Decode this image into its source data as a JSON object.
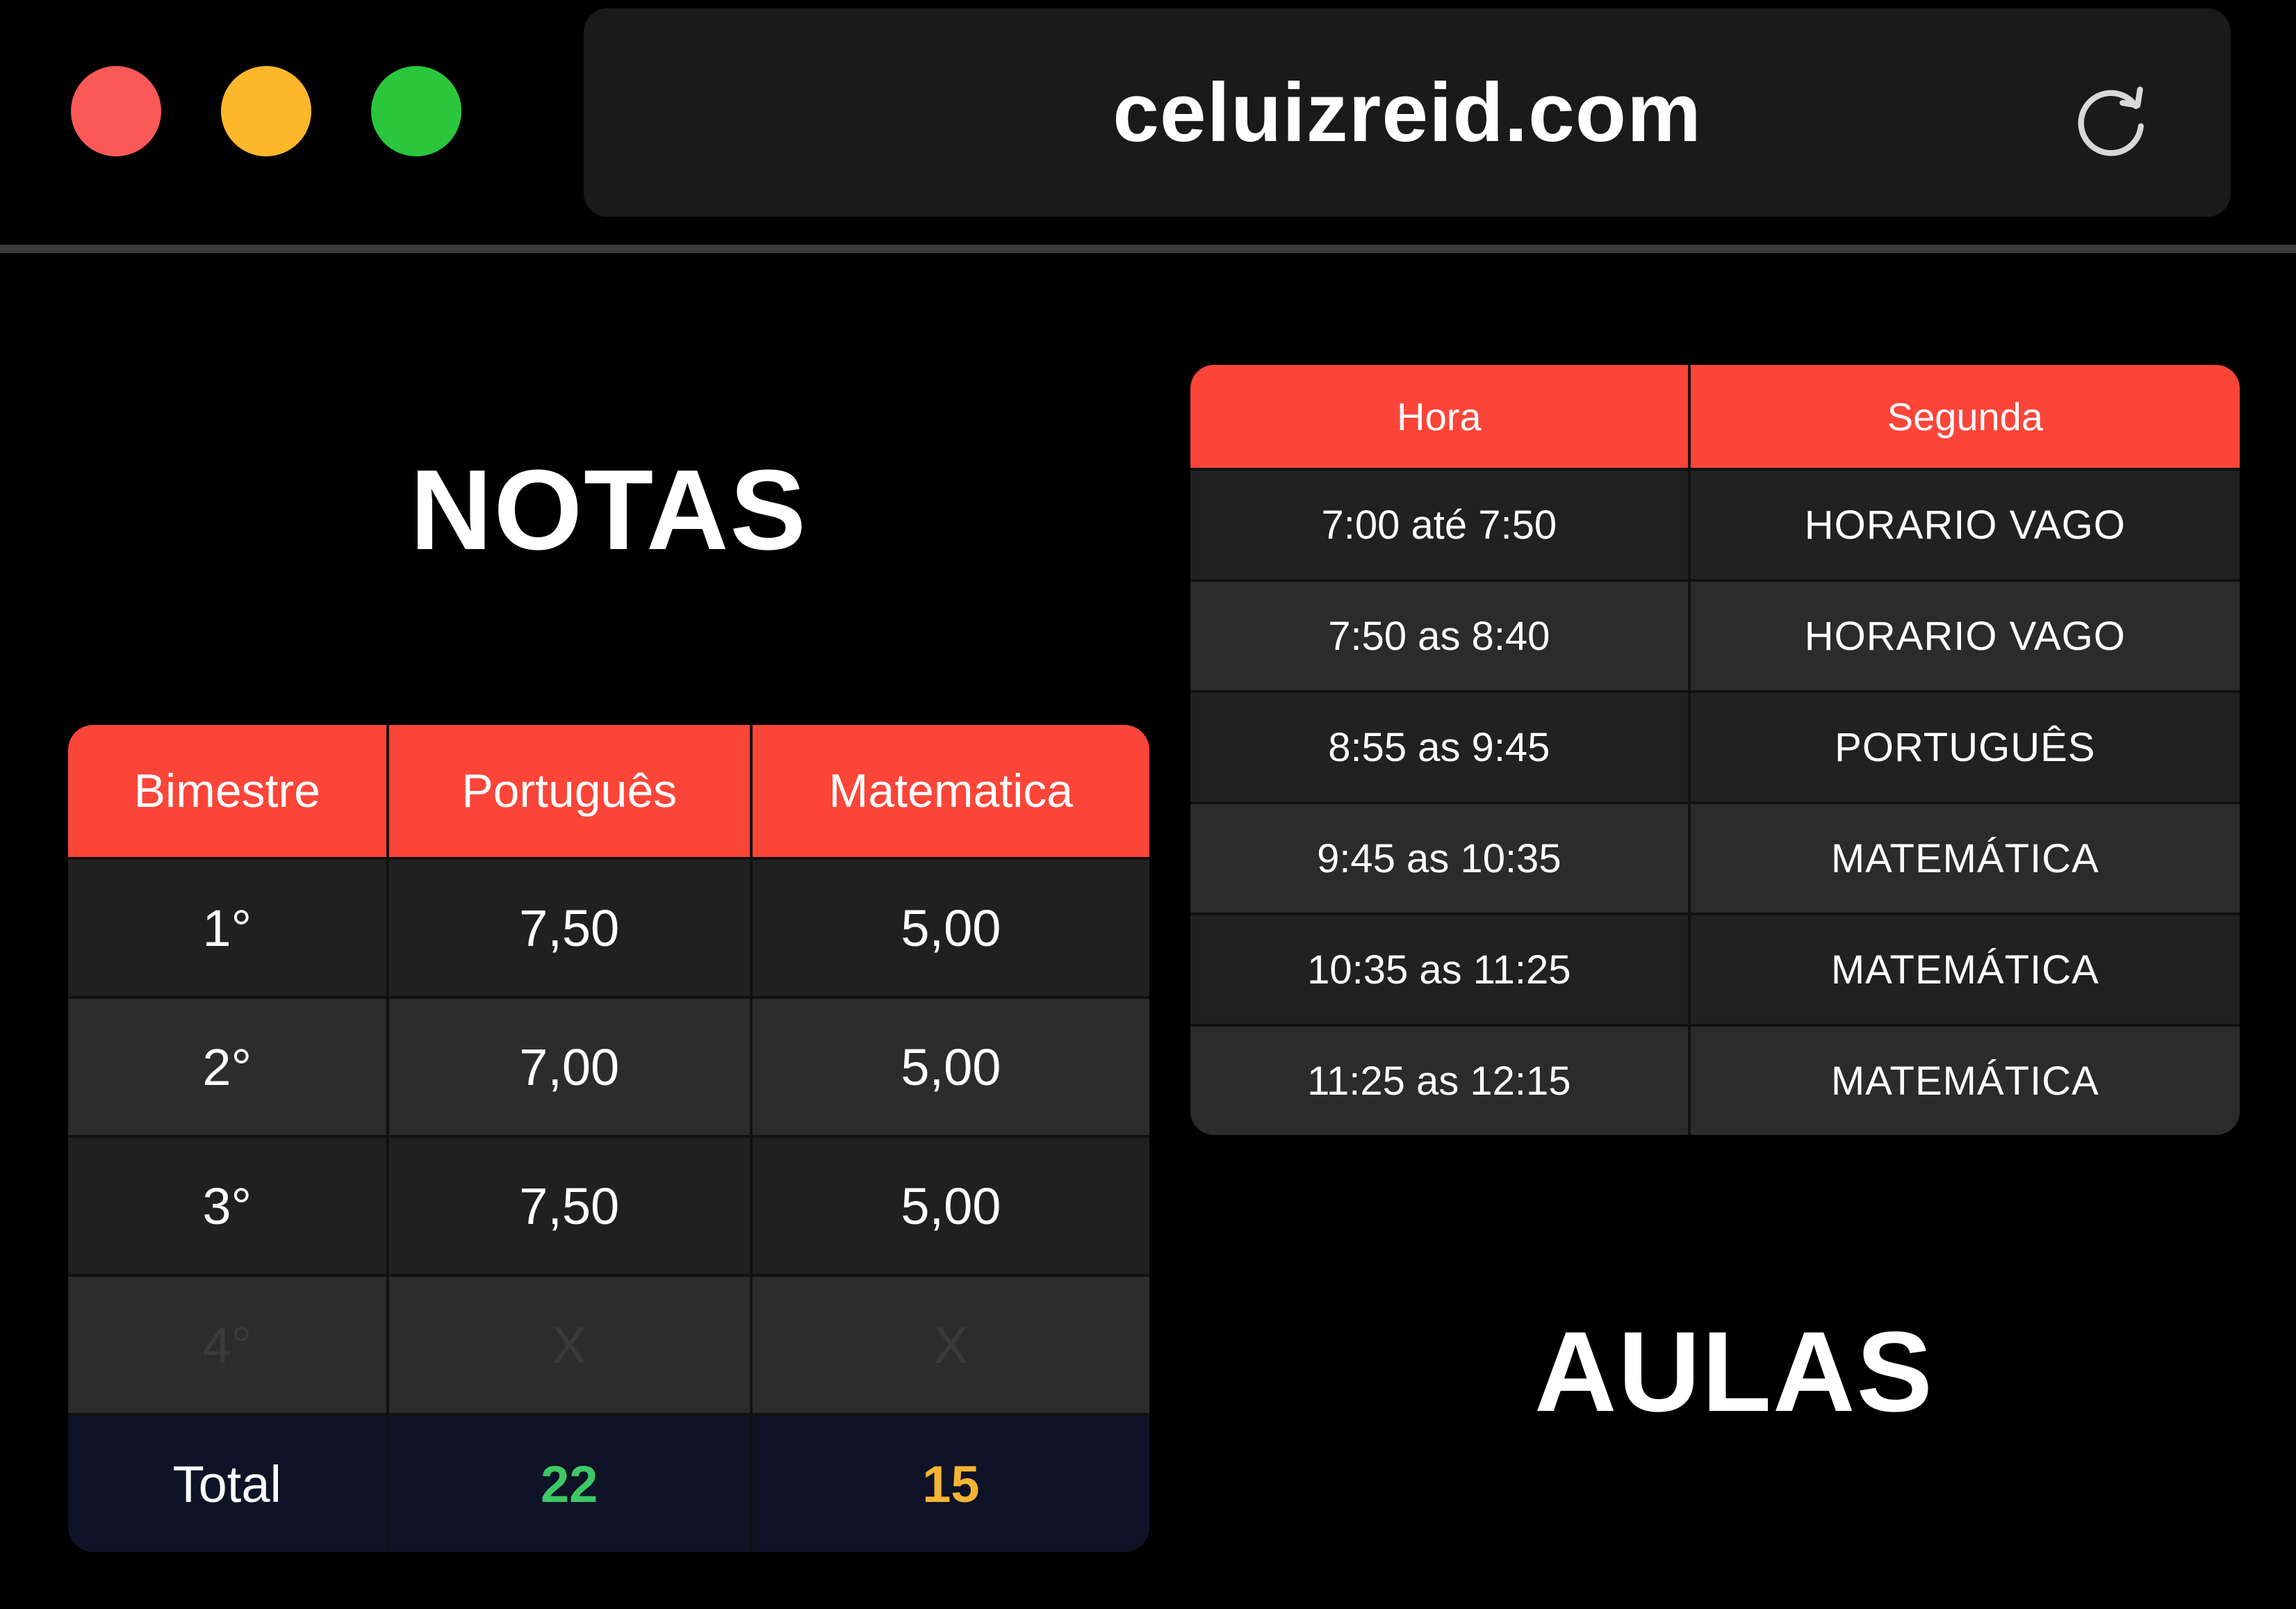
{
  "browser": {
    "url": "celuizreid.com",
    "reload_icon": "reload-icon",
    "buttons": {
      "close_color": "#fb5957",
      "minimize_color": "#fdb72b",
      "maximize_color": "#2ac73c"
    }
  },
  "accent_color": "#fb4539",
  "grades": {
    "title": "NOTAS",
    "headers": [
      "Bimestre",
      "Português",
      "Matematica"
    ],
    "rows": [
      [
        "1°",
        "7,50",
        "5,00"
      ],
      [
        "2°",
        "7,00",
        "5,00"
      ],
      [
        "3°",
        "7,50",
        "5,00"
      ],
      [
        "4°",
        "X",
        "X"
      ]
    ],
    "total": {
      "label": "Total",
      "portugues": "22",
      "matematica": "15"
    }
  },
  "schedule": {
    "title": "AULAS",
    "headers": [
      "Hora",
      "Segunda"
    ],
    "rows": [
      [
        "7:00 até 7:50",
        "HORARIO VAGO"
      ],
      [
        "7:50 as 8:40",
        "HORARIO VAGO"
      ],
      [
        "8:55 as 9:45",
        "PORTUGUÊS"
      ],
      [
        "9:45 as 10:35",
        "MATEMÁTICA"
      ],
      [
        "10:35 as 11:25",
        "MATEMÁTICA"
      ],
      [
        "11:25 as 12:15",
        "MATEMÁTICA"
      ]
    ]
  }
}
